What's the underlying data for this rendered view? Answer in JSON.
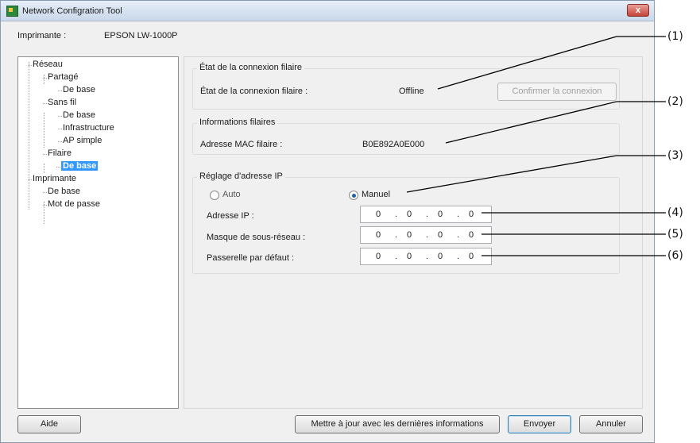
{
  "window": {
    "title": "Network Configration Tool",
    "close_glyph": "x"
  },
  "printer": {
    "label": "Imprimante :",
    "value": "EPSON LW-1000P"
  },
  "tree": {
    "items": [
      {
        "label": "Réseau"
      },
      {
        "label": "Partagé"
      },
      {
        "label": "De base"
      },
      {
        "label": "Sans fil"
      },
      {
        "label": "De base"
      },
      {
        "label": "Infrastructure"
      },
      {
        "label": "AP simple"
      },
      {
        "label": "Filaire"
      },
      {
        "label": "De base"
      },
      {
        "label": "Imprimante"
      },
      {
        "label": "De base"
      },
      {
        "label": "Mot de passe"
      }
    ],
    "selected_index": 8
  },
  "wired_status": {
    "group_title": "État de la connexion filaire",
    "label": "État de la connexion filaire :",
    "value": "Offline",
    "confirm_button": "Confirmer la connexion"
  },
  "wired_info": {
    "group_title": "Informations filaires",
    "mac_label": "Adresse MAC filaire :",
    "mac_value": "B0E892A0E000"
  },
  "ip_settings": {
    "group_title": "Réglage d'adresse IP",
    "auto_label": "Auto",
    "manual_label": "Manuel",
    "selected_mode": "Manuel",
    "ip_label": "Adresse IP :",
    "mask_label": "Masque de sous-réseau :",
    "gateway_label": "Passerelle par défaut :",
    "ip_value": [
      "0",
      "0",
      "0",
      "0"
    ],
    "mask_value": [
      "0",
      "0",
      "0",
      "0"
    ],
    "gateway_value": [
      "0",
      "0",
      "0",
      "0"
    ],
    "dot": "."
  },
  "footer": {
    "help_button": "Aide",
    "refresh_button": "Mettre à jour avec les dernières informations",
    "send_button": "Envoyer",
    "cancel_button": "Annuler"
  },
  "callouts": [
    "(1)",
    "(2)",
    "(3)",
    "(4)",
    "(5)",
    "(6)"
  ],
  "colors": {
    "selection": "#3399ff",
    "close_button": "#c4433a"
  }
}
